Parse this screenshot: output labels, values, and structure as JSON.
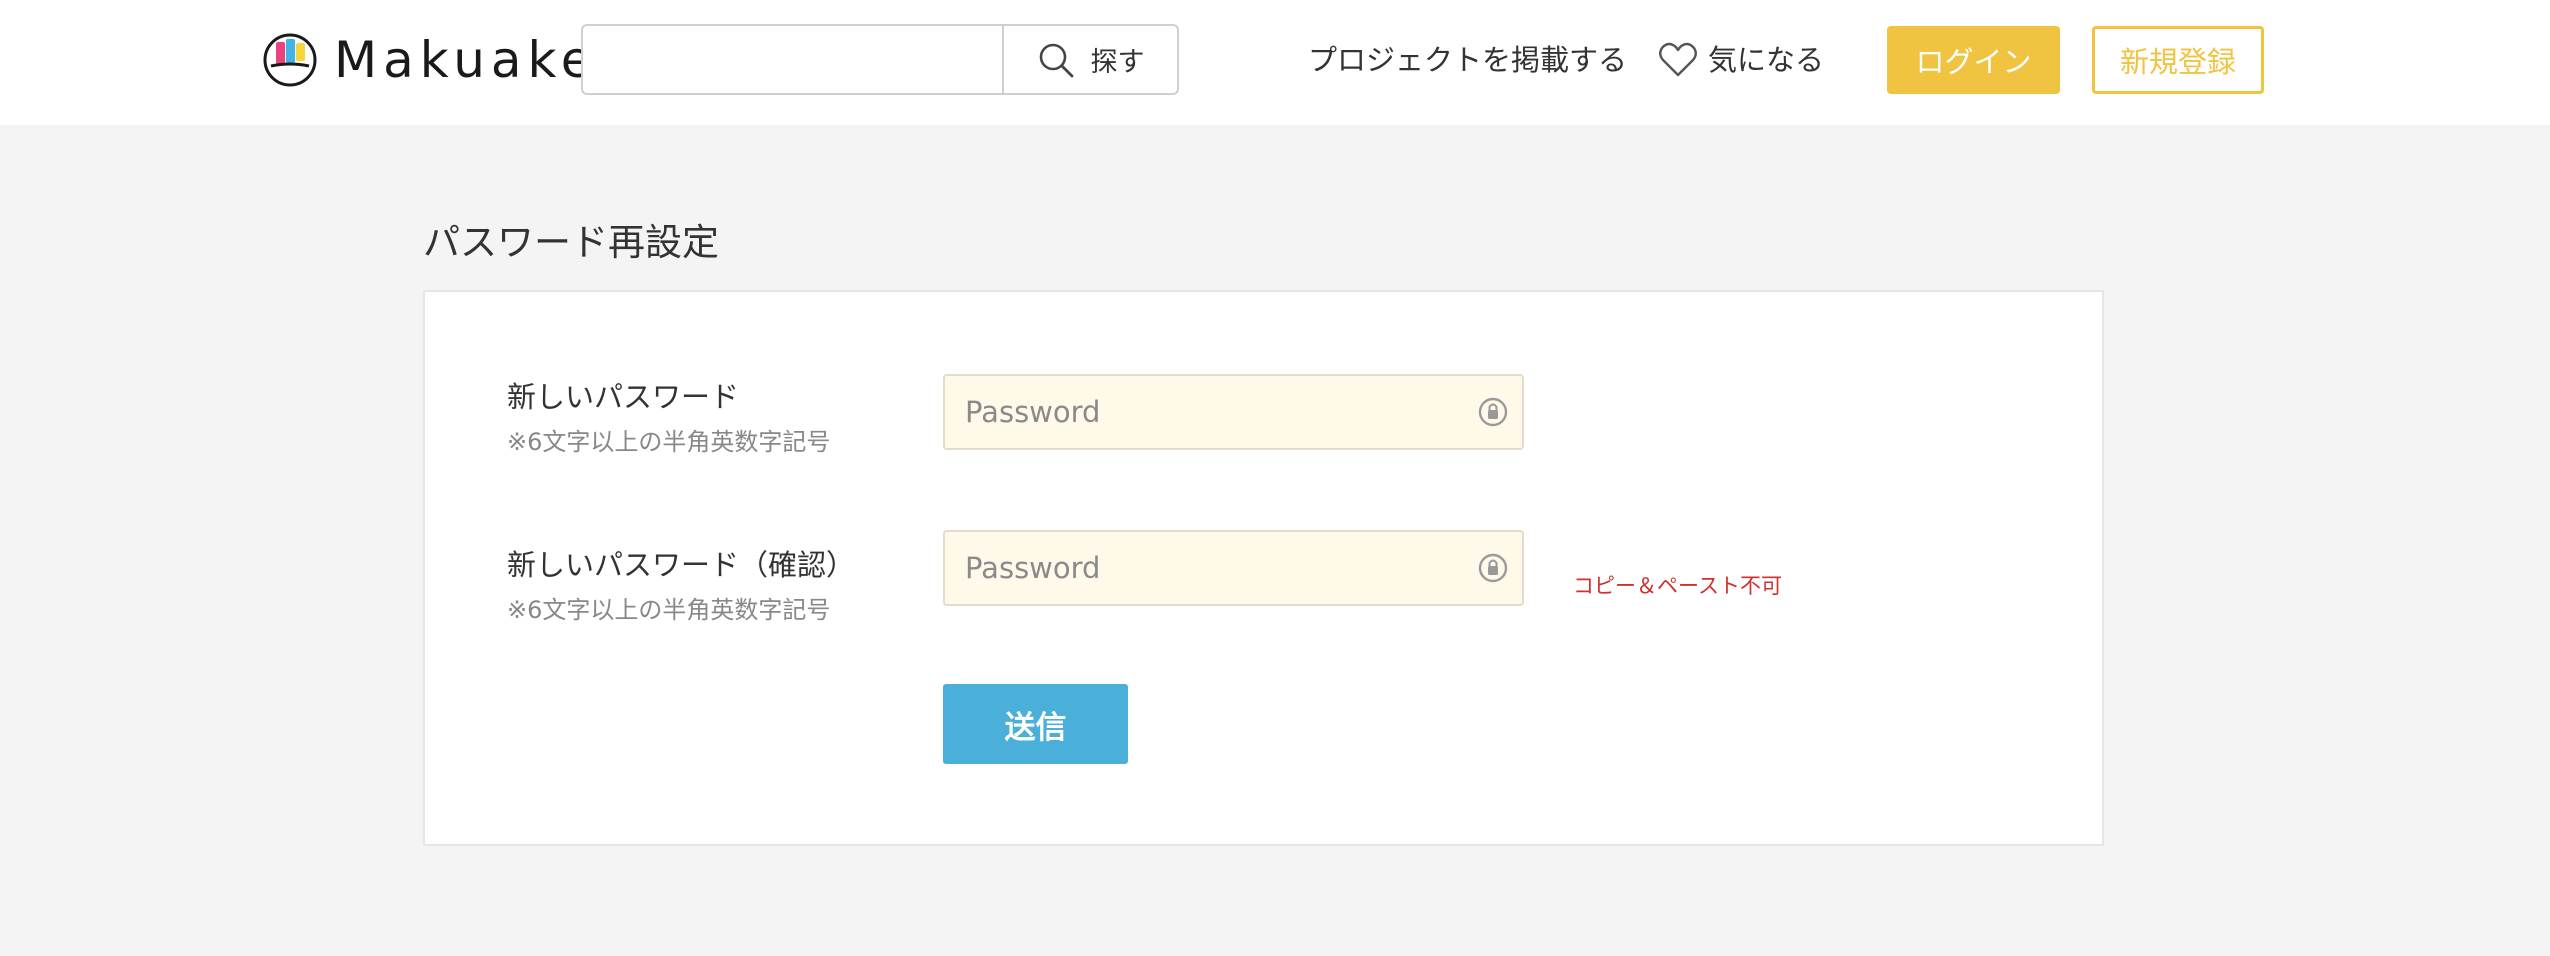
{
  "header": {
    "logo_text": "Makuake",
    "search": {
      "value": "",
      "placeholder": "",
      "button_label": "探す"
    },
    "nav": {
      "post_project": "プロジェクトを掲載する",
      "favorites": "気になる"
    },
    "login_label": "ログイン",
    "register_label": "新規登録",
    "colors": {
      "accent": "#f0c440"
    }
  },
  "page": {
    "title": "パスワード再設定",
    "fields": [
      {
        "label": "新しいパスワード",
        "note": "※6文字以上の半角英数字記号",
        "placeholder": "Password",
        "value": ""
      },
      {
        "label": "新しいパスワード（確認）",
        "note": "※6文字以上の半角英数字記号",
        "placeholder": "Password",
        "value": "",
        "warning": "コピー＆ペースト不可"
      }
    ],
    "submit_label": "送信",
    "colors": {
      "submit": "#4ab0d9",
      "warning": "#d0312d",
      "field_bg": "#fff9ea"
    }
  },
  "icons": [
    "logo-mark-icon",
    "search-icon",
    "heart-icon",
    "password-key-icon"
  ]
}
